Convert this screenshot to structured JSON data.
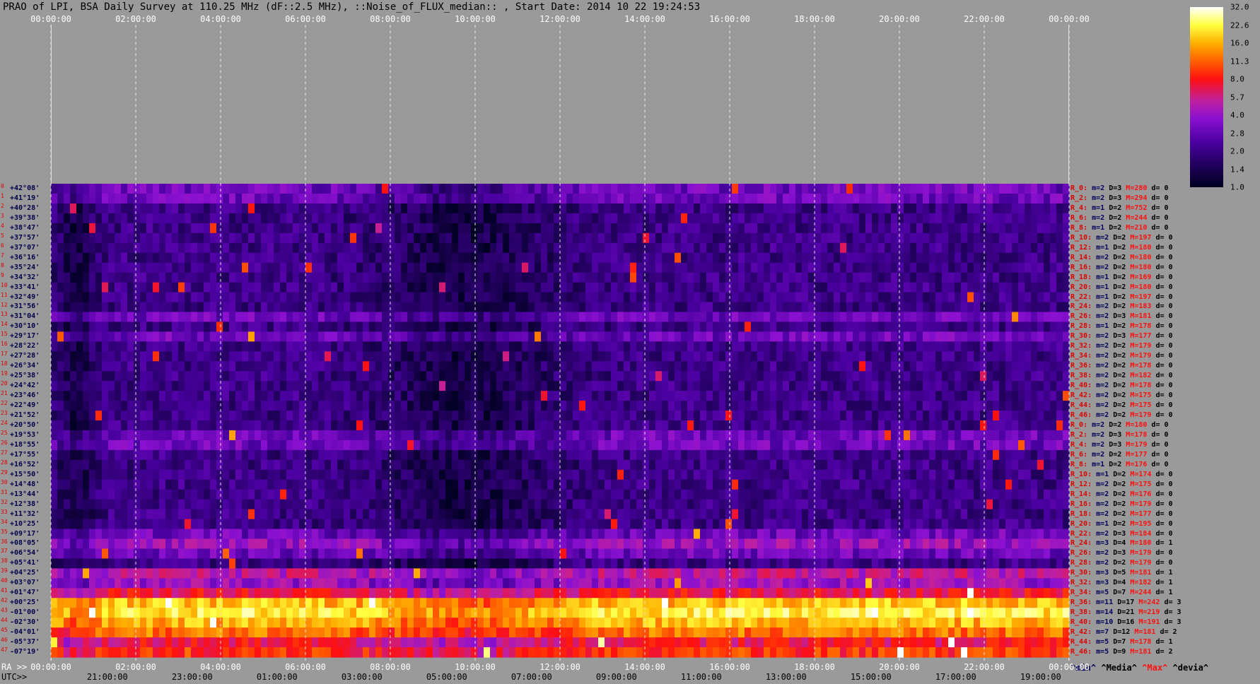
{
  "title": "PRAO of LPI, BSA Daily Survey at 110.25 MHz (dF::2.5 MHz), ::Noise_of_FLUX_median:: , Start Date: 2014 10 22 19:24:53",
  "top_axis_ticks": [
    "00:00:00",
    "02:00:00",
    "04:00:00",
    "06:00:00",
    "08:00:00",
    "10:00:00",
    "12:00:00",
    "14:00:00",
    "16:00:00",
    "18:00:00",
    "20:00:00",
    "22:00:00",
    "00:00:00"
  ],
  "bottom_axis": {
    "ra_prefix": "RA >>",
    "ra_ticks": [
      "00:00:00",
      "02:00:00",
      "04:00:00",
      "06:00:00",
      "08:00:00",
      "10:00:00",
      "12:00:00",
      "14:00:00",
      "16:00:00",
      "18:00:00",
      "20:00:00",
      "22:00:00",
      "00:00:00"
    ],
    "utc_prefix": "UTC>>",
    "utc_ticks": [
      "21:00:00",
      "23:00:00",
      "01:00:00",
      "03:00:00",
      "05:00:00",
      "07:00:00",
      "09:00:00",
      "11:00:00",
      "13:00:00",
      "15:00:00",
      "17:00:00",
      "19:00:00"
    ]
  },
  "colorbar": {
    "ticks": [
      "32.0",
      "22.6",
      "16.0",
      "11.3",
      "8.0",
      "5.7",
      "4.0",
      "2.8",
      "2.0",
      "1.4",
      "1.0"
    ],
    "colors": [
      "#000020",
      "#4a00a0",
      "#8a10d0",
      "#c020a0",
      "#ff1010",
      "#ff6000",
      "#ffb000",
      "#ffff40",
      "#ffffff"
    ]
  },
  "legend": {
    "min": "^min^",
    "median": "^Media^",
    "max": "^Max^",
    "devia": "^devia^"
  },
  "row_index_labels": [
    "0",
    "1",
    "2",
    "3",
    "4",
    "5",
    "6",
    "7",
    "8",
    "9",
    "10",
    "11",
    "12",
    "13",
    "14",
    "15",
    "16",
    "17",
    "18",
    "19",
    "20",
    "21",
    "22",
    "23",
    "24",
    "25",
    "26",
    "27",
    "28",
    "29",
    "30",
    "31",
    "32",
    "33",
    "34",
    "35",
    "36",
    "37",
    "38",
    "39",
    "40",
    "41",
    "42",
    "43",
    "44",
    "45",
    "46",
    "47"
  ],
  "chart_data": {
    "type": "heatmap",
    "x_axis": "RA (hours)",
    "xlim": [
      0,
      24
    ],
    "declinations": [
      "+42°08'",
      "+41°19'",
      "+40°28'",
      "+39°38'",
      "+38°47'",
      "+37°57'",
      "+37°07'",
      "+36°16'",
      "+35°24'",
      "+34°32'",
      "+33°41'",
      "+32°49'",
      "+31°56'",
      "+31°04'",
      "+30°10'",
      "+29°17'",
      "+28°22'",
      "+27°28'",
      "+26°34'",
      "+25°38'",
      "+24°42'",
      "+23°46'",
      "+22°49'",
      "+21°52'",
      "+20°50'",
      "+19°53'",
      "+18°55'",
      "+17°55'",
      "+16°52'",
      "+15°50'",
      "+14°48'",
      "+13°44'",
      "+12°38'",
      "+11°32'",
      "+10°25'",
      "+09°17'",
      "+08°05'",
      "+06°54'",
      "+05°41'",
      "+04°25'",
      "+03°07'",
      "+01°47'",
      "+00°25'",
      "-01°00'",
      "-02°30'",
      "-04°01'",
      "-05°37'",
      "-07°19'"
    ],
    "color_scale": {
      "min": 1.0,
      "max": 32.0,
      "scale": "log2"
    },
    "row_stats": [
      {
        "label": "R_0:",
        "min": 2,
        "median": 3,
        "max": 280,
        "dev": 0
      },
      {
        "label": "R_2:",
        "min": 2,
        "median": 3,
        "max": 294,
        "dev": 0
      },
      {
        "label": "R_4:",
        "min": 1,
        "median": 2,
        "max": 752,
        "dev": 0
      },
      {
        "label": "R_6:",
        "min": 2,
        "median": 2,
        "max": 244,
        "dev": 0
      },
      {
        "label": "R_8:",
        "min": 1,
        "median": 2,
        "max": 210,
        "dev": 0
      },
      {
        "label": "R_10:",
        "min": 2,
        "median": 2,
        "max": 197,
        "dev": 0
      },
      {
        "label": "R_12:",
        "min": 1,
        "median": 2,
        "max": 180,
        "dev": 0
      },
      {
        "label": "R_14:",
        "min": 2,
        "median": 2,
        "max": 180,
        "dev": 0
      },
      {
        "label": "R_16:",
        "min": 2,
        "median": 2,
        "max": 180,
        "dev": 0
      },
      {
        "label": "R_18:",
        "min": 1,
        "median": 2,
        "max": 169,
        "dev": 0
      },
      {
        "label": "R_20:",
        "min": 1,
        "median": 2,
        "max": 180,
        "dev": 0
      },
      {
        "label": "R_22:",
        "min": 1,
        "median": 2,
        "max": 197,
        "dev": 0
      },
      {
        "label": "R_24:",
        "min": 2,
        "median": 2,
        "max": 183,
        "dev": 0
      },
      {
        "label": "R_26:",
        "min": 2,
        "median": 3,
        "max": 181,
        "dev": 0
      },
      {
        "label": "R_28:",
        "min": 1,
        "median": 2,
        "max": 178,
        "dev": 0
      },
      {
        "label": "R_30:",
        "min": 2,
        "median": 3,
        "max": 177,
        "dev": 0
      },
      {
        "label": "R_32:",
        "min": 2,
        "median": 2,
        "max": 179,
        "dev": 0
      },
      {
        "label": "R_34:",
        "min": 2,
        "median": 2,
        "max": 179,
        "dev": 0
      },
      {
        "label": "R_36:",
        "min": 2,
        "median": 2,
        "max": 178,
        "dev": 0
      },
      {
        "label": "R_38:",
        "min": 2,
        "median": 2,
        "max": 182,
        "dev": 0
      },
      {
        "label": "R_40:",
        "min": 2,
        "median": 2,
        "max": 178,
        "dev": 0
      },
      {
        "label": "R_42:",
        "min": 2,
        "median": 2,
        "max": 175,
        "dev": 0
      },
      {
        "label": "R_44:",
        "min": 2,
        "median": 2,
        "max": 175,
        "dev": 0
      },
      {
        "label": "R_46:",
        "min": 2,
        "median": 2,
        "max": 179,
        "dev": 0
      },
      {
        "label": "R_0:",
        "min": 2,
        "median": 2,
        "max": 180,
        "dev": 0
      },
      {
        "label": "R_2:",
        "min": 2,
        "median": 3,
        "max": 178,
        "dev": 0
      },
      {
        "label": "R_4:",
        "min": 2,
        "median": 3,
        "max": 179,
        "dev": 0
      },
      {
        "label": "R_6:",
        "min": 2,
        "median": 2,
        "max": 177,
        "dev": 0
      },
      {
        "label": "R_8:",
        "min": 1,
        "median": 2,
        "max": 176,
        "dev": 0
      },
      {
        "label": "R_10:",
        "min": 1,
        "median": 2,
        "max": 174,
        "dev": 0
      },
      {
        "label": "R_12:",
        "min": 2,
        "median": 2,
        "max": 175,
        "dev": 0
      },
      {
        "label": "R_14:",
        "min": 2,
        "median": 2,
        "max": 176,
        "dev": 0
      },
      {
        "label": "R_16:",
        "min": 2,
        "median": 2,
        "max": 179,
        "dev": 0
      },
      {
        "label": "R_18:",
        "min": 2,
        "median": 2,
        "max": 177,
        "dev": 0
      },
      {
        "label": "R_20:",
        "min": 1,
        "median": 2,
        "max": 195,
        "dev": 0
      },
      {
        "label": "R_22:",
        "min": 2,
        "median": 3,
        "max": 184,
        "dev": 0
      },
      {
        "label": "R_24:",
        "min": 3,
        "median": 4,
        "max": 180,
        "dev": 1
      },
      {
        "label": "R_26:",
        "min": 2,
        "median": 3,
        "max": 179,
        "dev": 0
      },
      {
        "label": "R_28:",
        "min": 2,
        "median": 2,
        "max": 179,
        "dev": 0
      },
      {
        "label": "R_30:",
        "min": 3,
        "median": 5,
        "max": 181,
        "dev": 1
      },
      {
        "label": "R_32:",
        "min": 3,
        "median": 4,
        "max": 182,
        "dev": 1
      },
      {
        "label": "R_34:",
        "min": 5,
        "median": 7,
        "max": 244,
        "dev": 1
      },
      {
        "label": "R_36:",
        "min": 11,
        "median": 17,
        "max": 242,
        "dev": 3
      },
      {
        "label": "R_38:",
        "min": 14,
        "median": 21,
        "max": 219,
        "dev": 3
      },
      {
        "label": "R_40:",
        "min": 10,
        "median": 16,
        "max": 191,
        "dev": 3
      },
      {
        "label": "R_42:",
        "min": 7,
        "median": 12,
        "max": 181,
        "dev": 2
      },
      {
        "label": "R_44:",
        "min": 5,
        "median": 7,
        "max": 178,
        "dev": 1
      },
      {
        "label": "R_46:",
        "min": 5,
        "median": 9,
        "max": 181,
        "dev": 2
      }
    ]
  }
}
